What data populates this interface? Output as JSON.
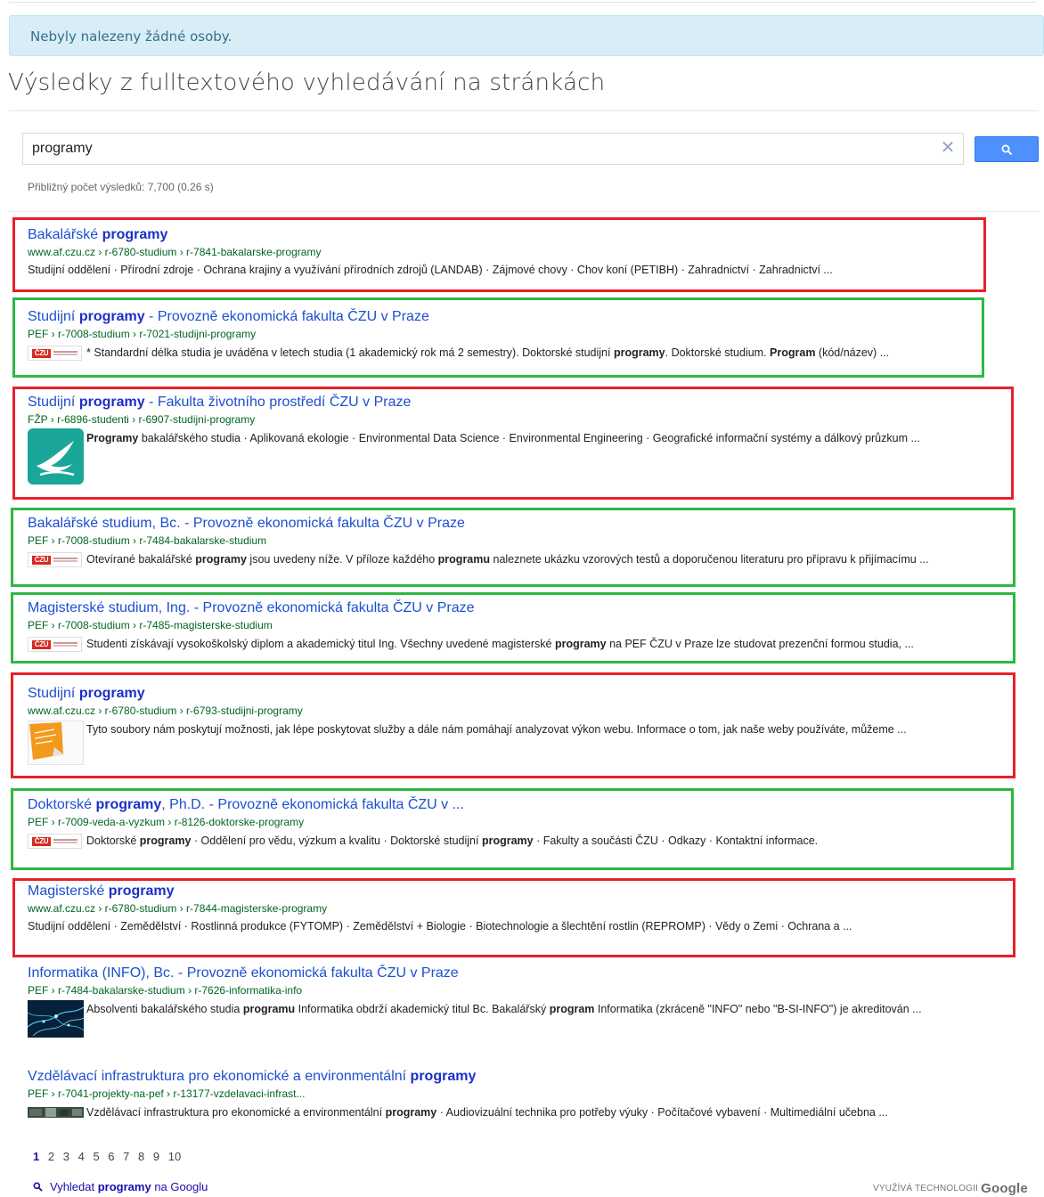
{
  "alert": {
    "text": "Nebyly nalezeny žádné osoby."
  },
  "heading": "Výsledky z fulltextového vyhledávání na stránkách",
  "search": {
    "value": "programy",
    "clear_icon": "close-icon",
    "button_icon": "search-icon"
  },
  "stats": "Přibližný počet výsledků: 7,700 (0.26 s)",
  "results": [
    {
      "title_html": "Bakalářské <b>programy</b>",
      "url": "www.af.czu.cz › r-6780-studium › r-7841-bakalarske-programy",
      "snippet_html": "Studijní oddělení · Přírodní zdroje · Ochrana krajiny a využívání přírodních zdrojů (LANDAB) · Zájmové chovy · Chov koní (PETIBH) · Zahradnictví · Zahradnictví ...",
      "thumb": "none",
      "highlight": "red"
    },
    {
      "title_html": "Studijní <b>programy</b> - Provozně ekonomická fakulta ČZU v Praze",
      "url": "PEF › r-7008-studium › r-7021-studijni-programy",
      "snippet_html": "* Standardní délka studia je uváděna v letech studia (1 akademický rok má 2 semestry). Doktorské studijní <b>programy</b>. Doktorské studium. <b>Program</b> (kód/název) ...",
      "thumb": "czu-logo",
      "highlight": "green"
    },
    {
      "title_html": "Studijní <b>programy</b> - Fakulta životního prostředí ČZU v Praze",
      "url": "FŽP › r-6896-studenti › r-6907-studijni-programy",
      "snippet_html": "<b>Programy</b> bakalářského studia · Aplikovaná ekologie · Environmental Data Science · Environmental Engineering · Geografické informační systémy a dálkový průzkum ...",
      "thumb": "bird-logo",
      "highlight": "red"
    },
    {
      "title_html": "Bakalářské studium, Bc. - Provozně ekonomická fakulta ČZU v Praze",
      "url": "PEF › r-7008-studium › r-7484-bakalarske-studium",
      "snippet_html": "Otevírané bakalářské <b>programy</b> jsou uvedeny níže. V příloze každého <b>programu</b> naleznete ukázku vzorových testů a doporučenou literaturu pro přípravu k přijímacímu ...",
      "thumb": "czu-logo",
      "highlight": "green"
    },
    {
      "title_html": "Magisterské studium, Ing. - Provozně ekonomická fakulta ČZU v Praze",
      "url": "PEF › r-7008-studium › r-7485-magisterske-studium",
      "snippet_html": "Studenti získávají vysokoškolský diplom a akademický titul Ing. Všechny uvedené magisterské <b>programy</b> na PEF ČZU v Praze lze studovat prezenční formou studia, ...",
      "thumb": "czu-logo",
      "highlight": "green"
    },
    {
      "title_html": "Studijní <b>programy</b>",
      "url": "www.af.czu.cz › r-6780-studium › r-6793-studijni-programy",
      "snippet_html": "Tyto soubory nám poskytují možnosti, jak lépe poskytovat služby a dále nám pomáhají analyzovat výkon webu. Informace o tom, jak naše weby používáte, můžeme ...",
      "thumb": "sticker",
      "highlight": "red"
    },
    {
      "title_html": "Doktorské <b>programy</b>, Ph.D. - Provozně ekonomická fakulta ČZU v ...",
      "url": "PEF › r-7009-veda-a-vyzkum › r-8126-doktorske-programy",
      "snippet_html": "Doktorské <b>programy</b> · Oddělení pro vědu, výzkum a kvalitu · Doktorské studijní <b>programy</b> · Fakulty a součásti ČZU · Odkazy · Kontaktní informace.",
      "thumb": "czu-logo",
      "highlight": "green"
    },
    {
      "title_html": "Magisterské <b>programy</b>",
      "url": "www.af.czu.cz › r-6780-studium › r-7844-magisterske-programy",
      "snippet_html": "Studijní oddělení · Zemědělství · Rostlinná produkce (FYTOMP) · Zemědělství + Biologie · Biotechnologie a šlechtění rostlin (REPROMP) · Vědy o Zemi · Ochrana a ...",
      "thumb": "none",
      "highlight": "red"
    },
    {
      "title_html": "Informatika (INFO), Bc. - Provozně ekonomická fakulta ČZU v Praze",
      "url": "PEF › r-7484-bakalarske-studium › r-7626-informatika-info",
      "snippet_html": "Absolventi bakalářského studia <b>programu</b> Informatika obdrží akademický titul Bc. Bakalářský <b>program</b> Informatika (zkráceně \"INFO\" nebo \"B-SI-INFO\") je akreditován ...",
      "thumb": "network-image",
      "highlight": "none"
    },
    {
      "title_html": "Vzdělávací infrastruktura pro ekonomické a environmentální <b>programy</b>",
      "url": "PEF › r-7041-projekty-na-pef › r-13177-vzdelavaci-infrast...",
      "snippet_html": "Vzdělávací infrastruktura pro ekonomické a environmentální <b>programy</b> · Audiovizuální technika pro potřeby výuky · Počítačové vybavení · Multimediální učebna ...",
      "thumb": "strip-image",
      "highlight": "none"
    }
  ],
  "pagination": {
    "current": "1",
    "pages": [
      "2",
      "3",
      "4",
      "5",
      "6",
      "7",
      "8",
      "9",
      "10"
    ]
  },
  "google_search": {
    "prefix": "Vyhledat",
    "term": "programy",
    "suffix": "na Googlu",
    "icon": "search-icon"
  },
  "branding": {
    "text": "VYUŽÍVÁ TECHNOLOGII",
    "logo": "Google"
  },
  "colors": {
    "highlight_red": "#e8202a",
    "highlight_green": "#2eb843",
    "title_blue": "#1a0dab",
    "url_green": "#006621",
    "alert_bg": "#d9edf7"
  }
}
